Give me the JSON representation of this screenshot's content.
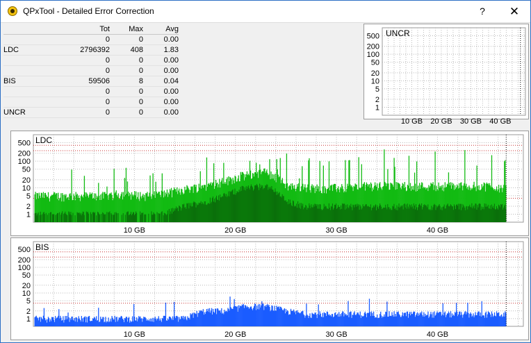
{
  "window": {
    "title": "QPxTool - Detailed Error Correction",
    "help_label": "?",
    "close_label": "✕"
  },
  "stats": {
    "headers": [
      "",
      "Tot",
      "Max",
      "Avg"
    ],
    "rows": [
      {
        "label": "",
        "tot": "0",
        "max": "0",
        "avg": "0.00"
      },
      {
        "label": "LDC",
        "tot": "2796392",
        "max": "408",
        "avg": "1.83"
      },
      {
        "label": "",
        "tot": "0",
        "max": "0",
        "avg": "0.00"
      },
      {
        "label": "",
        "tot": "0",
        "max": "0",
        "avg": "0.00"
      },
      {
        "label": "BIS",
        "tot": "59506",
        "max": "8",
        "avg": "0.04"
      },
      {
        "label": "",
        "tot": "0",
        "max": "0",
        "avg": "0.00"
      },
      {
        "label": "",
        "tot": "0",
        "max": "0",
        "avg": "0.00"
      },
      {
        "label": "UNCR",
        "tot": "0",
        "max": "0",
        "avg": "0.00"
      }
    ]
  },
  "colors": {
    "ldc_light": "#12bb12",
    "ldc_dark": "#0a6f0a",
    "bis": "#1a5cff",
    "grid": "#b9b9b9",
    "threshold": "#c83232",
    "end_marker": "#000000"
  },
  "chart_data": [
    {
      "type": "bar",
      "title": "UNCR",
      "yscale": "log",
      "y_ticks": [
        "500",
        "200",
        "100",
        "50",
        "20",
        "10",
        "5",
        "2",
        "1"
      ],
      "x_ticks": [
        "10 GB",
        "20 GB",
        "30 GB",
        "40 GB"
      ],
      "xlim": [
        0,
        48.5
      ],
      "end_marker": 46.8,
      "series": []
    },
    {
      "type": "bar",
      "title": "LDC",
      "yscale": "log",
      "y_ticks": [
        "500",
        "200",
        "100",
        "50",
        "20",
        "10",
        "5",
        "2",
        "1"
      ],
      "x_ticks": [
        "10 GB",
        "20 GB",
        "30 GB",
        "40 GB"
      ],
      "xlim": [
        0,
        48.5
      ],
      "thresholds": [
        400,
        250,
        4
      ],
      "end_marker": 46.8,
      "series": [
        {
          "x": [
            1,
            3,
            5,
            7,
            9,
            11,
            13,
            15,
            17,
            19,
            21,
            23,
            25,
            27,
            29,
            31,
            33,
            35,
            37,
            39,
            41,
            43,
            45,
            46.5
          ],
          "values": [
            5,
            5,
            5,
            5,
            6,
            5,
            6,
            9,
            12,
            18,
            30,
            40,
            12,
            10,
            10,
            10,
            12,
            12,
            12,
            12,
            12,
            12,
            12,
            10
          ],
          "peaks": [
            100,
            80,
            60,
            40,
            60,
            40,
            30,
            60,
            150,
            100,
            100,
            50,
            300,
            200,
            100,
            120,
            250,
            300,
            200,
            200,
            250,
            300,
            300,
            100
          ]
        },
        {
          "x": [
            1,
            3,
            5,
            7,
            9,
            11,
            13,
            15,
            17,
            19,
            21,
            23,
            25,
            27,
            29,
            31,
            33,
            35,
            37,
            39,
            41,
            43,
            45,
            46.5
          ],
          "values": [
            1,
            1,
            1,
            1,
            1,
            1,
            1,
            2,
            3,
            5,
            10,
            12,
            3,
            2,
            2,
            2,
            2,
            2,
            2,
            2,
            2,
            2,
            2,
            2
          ]
        }
      ]
    },
    {
      "type": "bar",
      "title": "BIS",
      "yscale": "log",
      "y_ticks": [
        "500",
        "200",
        "100",
        "50",
        "20",
        "10",
        "5",
        "2",
        "1"
      ],
      "x_ticks": [
        "10 GB",
        "20 GB",
        "30 GB",
        "40 GB"
      ],
      "xlim": [
        0,
        48.5
      ],
      "thresholds": [
        400,
        250,
        4
      ],
      "end_marker": 46.8,
      "series": [
        {
          "x": [
            1,
            3,
            5,
            7,
            9,
            11,
            13,
            15,
            17,
            19,
            21,
            23,
            25,
            27,
            29,
            31,
            33,
            35,
            37,
            39,
            41,
            43,
            45,
            46.5
          ],
          "values": [
            1,
            1,
            1,
            1,
            1,
            1,
            1,
            1,
            2,
            2,
            3,
            3,
            2,
            1.5,
            1.5,
            1.5,
            1.5,
            1.5,
            1.5,
            1.5,
            1.5,
            1.5,
            1.5,
            1.5
          ],
          "peaks": [
            3,
            4,
            3,
            3,
            3,
            3,
            3,
            4,
            4,
            6,
            6,
            5,
            7,
            4,
            4,
            4,
            5,
            4,
            4,
            4,
            4,
            4,
            8,
            4
          ]
        }
      ]
    }
  ]
}
